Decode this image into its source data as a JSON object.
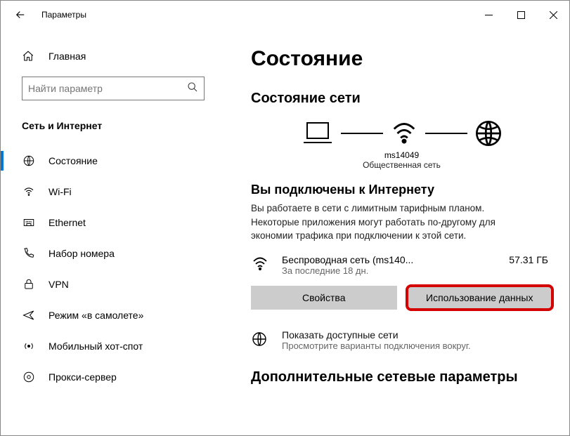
{
  "titlebar": {
    "title": "Параметры"
  },
  "sidebar": {
    "home": "Главная",
    "search_placeholder": "Найти параметр",
    "category": "Сеть и Интернет",
    "items": [
      {
        "label": "Состояние"
      },
      {
        "label": "Wi-Fi"
      },
      {
        "label": "Ethernet"
      },
      {
        "label": "Набор номера"
      },
      {
        "label": "VPN"
      },
      {
        "label": "Режим «в самолете»"
      },
      {
        "label": "Мобильный хот-спот"
      },
      {
        "label": "Прокси-сервер"
      }
    ]
  },
  "main": {
    "heading": "Состояние",
    "status_heading": "Состояние сети",
    "network_name": "ms14049",
    "network_type": "Общественная сеть",
    "connected_heading": "Вы подключены к Интернету",
    "connected_text": "Вы работаете в сети с лимитным тарифным планом. Некоторые приложения могут работать по-другому для экономии трафика при подключении к этой сети.",
    "connection": {
      "name": "Беспроводная сеть (ms140...",
      "period": "За последние 18 дн.",
      "usage": "57.31 ГБ"
    },
    "btn_properties": "Свойства",
    "btn_data_usage": "Использование данных",
    "show_available": "Показать доступные сети",
    "show_available_sub": "Просмотрите варианты подключения вокруг.",
    "extra_heading": "Дополнительные сетевые параметры"
  }
}
